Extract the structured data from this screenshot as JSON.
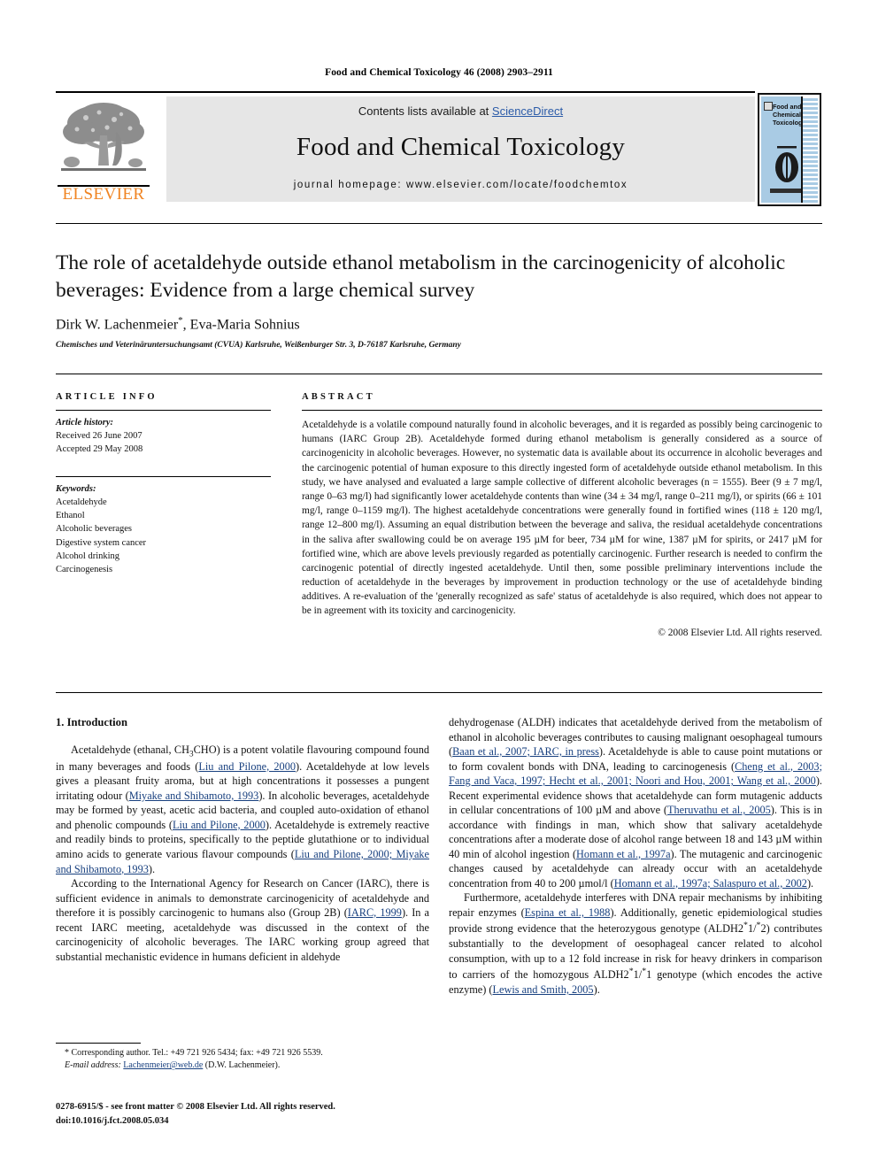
{
  "running_head": "Food and Chemical Toxicology 46 (2008) 2903–2911",
  "masthead": {
    "contents_prefix": "Contents lists available at ",
    "sciencedirect": "ScienceDirect",
    "journal_title": "Food and Chemical Toxicology",
    "homepage": "journal homepage: www.elsevier.com/locate/foodchemtox",
    "publisher_wordmark": "ELSEVIER",
    "cover_title": "Food and Chemical Toxicology"
  },
  "article": {
    "title": "The role of acetaldehyde outside ethanol metabolism in the carcinogenicity of alcoholic beverages: Evidence from a large chemical survey",
    "authors": "Dirk W. Lachenmeier",
    "authors_rest": ", Eva-Maria Sohnius",
    "corresponding_marker": "*",
    "affiliation": "Chemisches und Veterinäruntersuchungsamt (CVUA) Karlsruhe, Weißenburger Str. 3, D-76187 Karlsruhe, Germany"
  },
  "info": {
    "heading": "ARTICLE INFO",
    "history_label": "Article history:",
    "received": "Received 26 June 2007",
    "accepted": "Accepted 29 May 2008",
    "keywords_label": "Keywords:",
    "keywords": [
      "Acetaldehyde",
      "Ethanol",
      "Alcoholic beverages",
      "Digestive system cancer",
      "Alcohol drinking",
      "Carcinogenesis"
    ]
  },
  "abstract": {
    "heading": "ABSTRACT",
    "text": "Acetaldehyde is a volatile compound naturally found in alcoholic beverages, and it is regarded as possibly being carcinogenic to humans (IARC Group 2B). Acetaldehyde formed during ethanol metabolism is generally considered as a source of carcinogenicity in alcoholic beverages. However, no systematic data is available about its occurrence in alcoholic beverages and the carcinogenic potential of human exposure to this directly ingested form of acetaldehyde outside ethanol metabolism. In this study, we have analysed and evaluated a large sample collective of different alcoholic beverages (n = 1555). Beer (9 ± 7 mg/l, range 0–63 mg/l) had significantly lower acetaldehyde contents than wine (34 ± 34 mg/l, range 0–211 mg/l), or spirits (66 ± 101 mg/l, range 0–1159 mg/l). The highest acetaldehyde concentrations were generally found in fortified wines (118 ± 120 mg/l, range 12–800 mg/l). Assuming an equal distribution between the beverage and saliva, the residual acetaldehyde concentrations in the saliva after swallowing could be on average 195 µM for beer, 734 µM for wine, 1387 µM for spirits, or 2417 µM for fortified wine, which are above levels previously regarded as potentially carcinogenic. Further research is needed to confirm the carcinogenic potential of directly ingested acetaldehyde. Until then, some possible preliminary interventions include the reduction of acetaldehyde in the beverages by improvement in production technology or the use of acetaldehyde binding additives. A re-evaluation of the 'generally recognized as safe' status of acetaldehyde is also required, which does not appear to be in agreement with its toxicity and carcinogenicity.",
    "copyright": "© 2008 Elsevier Ltd. All rights reserved."
  },
  "body": {
    "section_heading": "1. Introduction",
    "left_paragraphs": [
      {
        "runs": [
          {
            "t": "Acetaldehyde (ethanal, CH"
          },
          {
            "t": "3",
            "s": "sub"
          },
          {
            "t": "CHO) is a potent volatile flavouring compound found in many beverages and foods ("
          },
          {
            "t": "Liu and Pilone, 2000",
            "s": "ref"
          },
          {
            "t": "). Acetaldehyde at low levels gives a pleasant fruity aroma, but at high concentrations it possesses a pungent irritating odour ("
          },
          {
            "t": "Miyake and Shibamoto, 1993",
            "s": "ref"
          },
          {
            "t": "). In alcoholic beverages, acetaldehyde may be formed by yeast, acetic acid bacteria, and coupled auto-oxidation of ethanol and phenolic compounds ("
          },
          {
            "t": "Liu and Pilone, 2000",
            "s": "ref"
          },
          {
            "t": "). Acetaldehyde is extremely reactive and readily binds to proteins, specifically to the peptide glutathione or to individual amino acids to generate various flavour compounds ("
          },
          {
            "t": "Liu and Pilone, 2000; Miyake and Shibamoto, 1993",
            "s": "ref"
          },
          {
            "t": ")."
          }
        ]
      },
      {
        "runs": [
          {
            "t": "According to the International Agency for Research on Cancer (IARC), there is sufficient evidence in animals to demonstrate carcinogenicity of acetaldehyde and therefore it is possibly carcinogenic to humans also (Group 2B) ("
          },
          {
            "t": "IARC, 1999",
            "s": "ref"
          },
          {
            "t": "). In a recent IARC meeting, acetaldehyde was discussed in the context of the carcinogenicity of alcoholic beverages. The IARC working group agreed that substantial mechanistic evidence in humans deficient in aldehyde"
          }
        ]
      }
    ],
    "right_paragraphs": [
      {
        "no_indent": true,
        "runs": [
          {
            "t": "dehydrogenase (ALDH) indicates that acetaldehyde derived from the metabolism of ethanol in alcoholic beverages contributes to causing malignant oesophageal tumours ("
          },
          {
            "t": "Baan et al., 2007; IARC, in press",
            "s": "ref"
          },
          {
            "t": "). Acetaldehyde is able to cause point mutations or to form covalent bonds with DNA, leading to carcinogenesis ("
          },
          {
            "t": "Cheng et al., 2003; Fang and Vaca, 1997; Hecht et al., 2001; Noori and Hou, 2001; Wang et al., 2000",
            "s": "ref"
          },
          {
            "t": "). Recent experimental evidence shows that acetaldehyde can form mutagenic adducts in cellular concentrations of 100 µM and above ("
          },
          {
            "t": "Theruvathu et al., 2005",
            "s": "ref"
          },
          {
            "t": "). This is in accordance with findings in man, which show that salivary acetaldehyde concentrations after a moderate dose of alcohol range between 18 and 143 µM within 40 min of alcohol ingestion ("
          },
          {
            "t": "Homann et al., 1997a",
            "s": "ref"
          },
          {
            "t": "). The mutagenic and carcinogenic changes caused by acetaldehyde can already occur with an acetaldehyde concentration from 40 to 200 µmol/l ("
          },
          {
            "t": "Homann et al., 1997a; Salaspuro et al., 2002",
            "s": "ref"
          },
          {
            "t": ")."
          }
        ]
      },
      {
        "runs": [
          {
            "t": "Furthermore, acetaldehyde interferes with DNA repair mechanisms by inhibiting repair enzymes ("
          },
          {
            "t": "Espina et al., 1988",
            "s": "ref"
          },
          {
            "t": "). Additionally, genetic epidemiological studies provide strong evidence that the heterozygous genotype (ALDH2"
          },
          {
            "t": "*",
            "s": "star"
          },
          {
            "t": "1/"
          },
          {
            "t": "*",
            "s": "star"
          },
          {
            "t": "2) contributes substantially to the development of oesophageal cancer related to alcohol consumption, with up to a 12 fold increase in risk for heavy drinkers in comparison to carriers of the homozygous ALDH2"
          },
          {
            "t": "*",
            "s": "star"
          },
          {
            "t": "1/"
          },
          {
            "t": "*",
            "s": "star"
          },
          {
            "t": "1 genotype (which encodes the active enzyme) ("
          },
          {
            "t": "Lewis and Smith, 2005",
            "s": "ref"
          },
          {
            "t": ")."
          }
        ]
      }
    ]
  },
  "footnotes": {
    "corresponding_marker": "*",
    "corresponding": "Corresponding author. Tel.: +49 721 926 5434; fax: +49 721 926 5539.",
    "email_label": "E-mail address:",
    "email": "Lachenmeier@web.de",
    "email_suffix": " (D.W. Lachenmeier).",
    "issn_line": "0278-6915/$ - see front matter © 2008 Elsevier Ltd. All rights reserved.",
    "doi_line": "doi:10.1016/j.fct.2008.05.034"
  },
  "colors": {
    "link": "#18407f",
    "sciencedirect": "#2b5ba8",
    "elsevier_orange": "#f08422",
    "band_grey": "#e6e6e6",
    "cover_blue": "#a9cbe4"
  }
}
